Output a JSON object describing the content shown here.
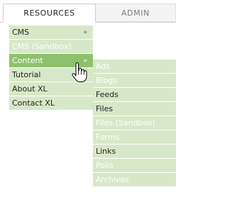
{
  "tabs": {
    "resources": "RESOURCES",
    "admin": "ADMIN"
  },
  "menu1": {
    "items": [
      {
        "label": "CMS",
        "chevron": "»"
      },
      {
        "label": "CMS (Sandbox)",
        "chevron": ""
      },
      {
        "label": "Content",
        "chevron": "»"
      },
      {
        "label": "Tutorial",
        "chevron": ""
      },
      {
        "label": "About XL",
        "chevron": ""
      },
      {
        "label": "Contact XL",
        "chevron": ""
      }
    ]
  },
  "menu2": {
    "items": [
      {
        "label": "Ads"
      },
      {
        "label": "Blogs"
      },
      {
        "label": "Feeds"
      },
      {
        "label": "Files"
      },
      {
        "label": "Files (Sandbox)"
      },
      {
        "label": "Forms"
      },
      {
        "label": "Links"
      },
      {
        "label": "Polls"
      },
      {
        "label": "Archives"
      }
    ]
  },
  "cursor": {
    "icon": "hand-pointer-icon"
  },
  "colors": {
    "menu_bg": "#d7e8c8",
    "menu_active": "#8fc16d",
    "disabled_text": "#ffffff",
    "text": "#222222"
  }
}
